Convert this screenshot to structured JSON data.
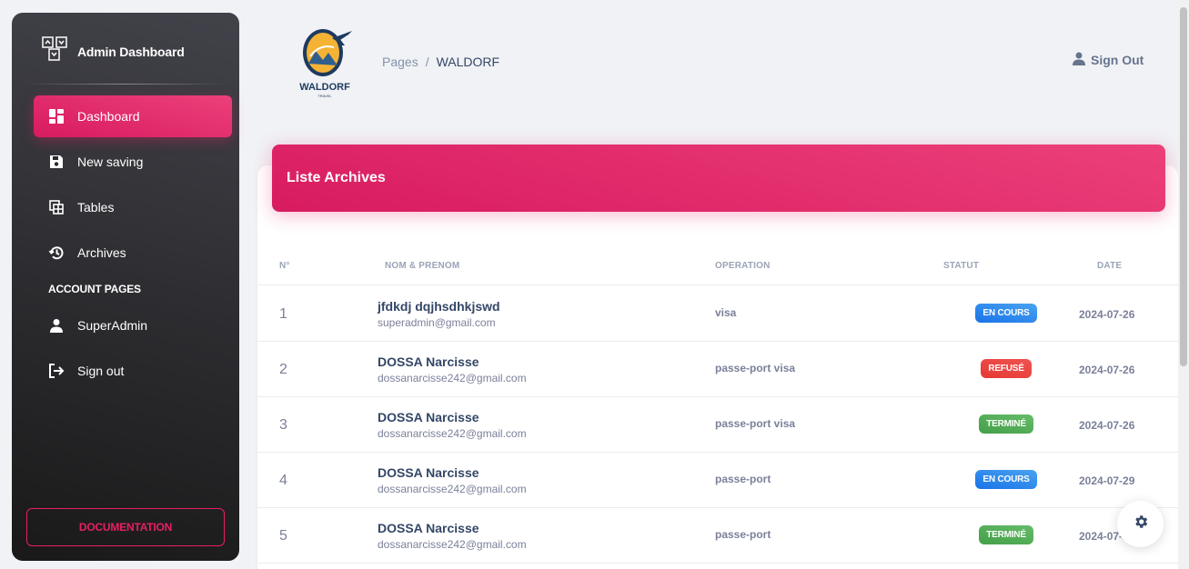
{
  "sidebar": {
    "brand_title": "Admin Dashboard",
    "items": [
      {
        "label": "Dashboard",
        "icon": "dashboard-icon",
        "active": true
      },
      {
        "label": "New saving",
        "icon": "save-icon"
      },
      {
        "label": "Tables",
        "icon": "table-icon"
      },
      {
        "label": "Archives",
        "icon": "history-icon"
      }
    ],
    "section_label": "ACCOUNT PAGES",
    "account_items": [
      {
        "label": "SuperAdmin",
        "icon": "user-icon"
      },
      {
        "label": "Sign out",
        "icon": "logout-icon"
      }
    ],
    "doc_button": "DOCUMENTATION"
  },
  "header": {
    "logo_text": "WALDORF",
    "logo_subtext": "TRAVEL",
    "breadcrumb_root": "Pages",
    "breadcrumb_sep": "/",
    "breadcrumb_current": "WALDORF",
    "signout_label": "Sign Out"
  },
  "card": {
    "title": "Liste Archives",
    "columns": [
      "N°",
      "NOM & PRENOM",
      "OPERATION",
      "STATUT",
      "DATE"
    ],
    "rows": [
      {
        "num": "1",
        "name": "jfdkdj dqjhsdhkjswd",
        "email": "superadmin@gmail.com",
        "operation": "visa",
        "status": "EN COURS",
        "status_type": "info",
        "date": "2024-07-26"
      },
      {
        "num": "2",
        "name": "DOSSA Narcisse",
        "email": "dossanarcisse242@gmail.com",
        "operation": "passe-port visa",
        "status": "REFUSÉ",
        "status_type": "danger",
        "date": "2024-07-26"
      },
      {
        "num": "3",
        "name": "DOSSA Narcisse",
        "email": "dossanarcisse242@gmail.com",
        "operation": "passe-port visa",
        "status": "TERMINÉ",
        "status_type": "success",
        "date": "2024-07-26"
      },
      {
        "num": "4",
        "name": "DOSSA Narcisse",
        "email": "dossanarcisse242@gmail.com",
        "operation": "passe-port",
        "status": "EN COURS",
        "status_type": "info",
        "date": "2024-07-29"
      },
      {
        "num": "5",
        "name": "DOSSA Narcisse",
        "email": "dossanarcisse242@gmail.com",
        "operation": "passe-port",
        "status": "TERMINÉ",
        "status_type": "success",
        "date": "2024-07-29"
      }
    ]
  },
  "fab_icon": "gear-icon",
  "colors": {
    "accent": "#e91e63",
    "info": "#1a73e8",
    "danger": "#e53935",
    "success": "#43a047"
  }
}
